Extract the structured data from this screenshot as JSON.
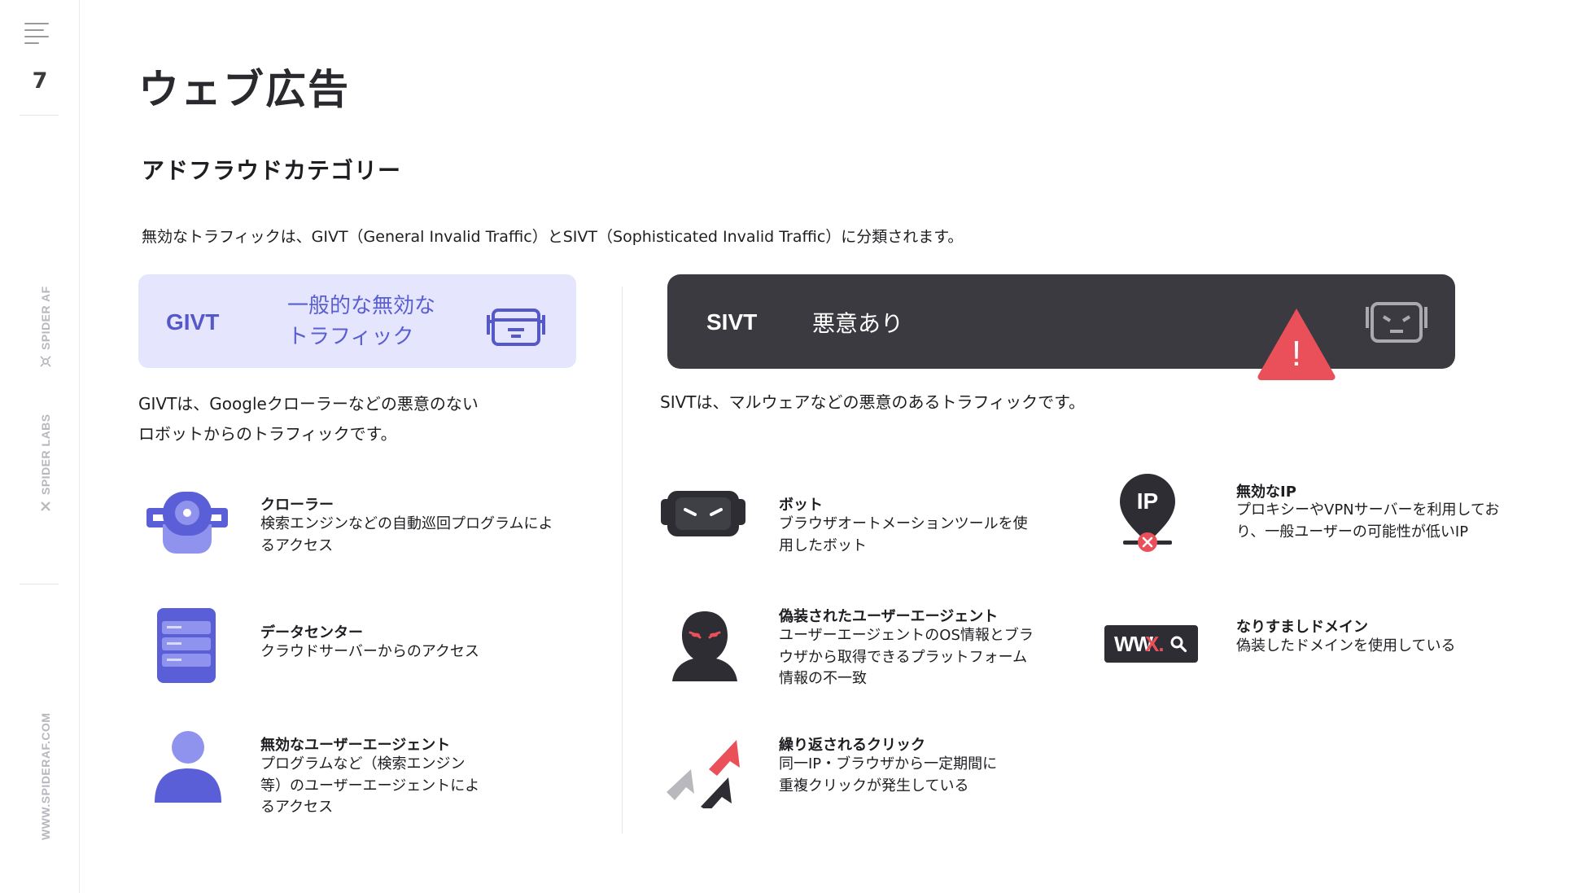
{
  "rail": {
    "page_number": "7",
    "brand_spider_af": "SPIDER AF",
    "brand_spider_labs": "SPIDER LABS",
    "website": "WWW.SPIDERAF.COM"
  },
  "title": "ウェブ広告",
  "section_title": "アドフラウドカテゴリー",
  "intro": "無効なトラフィックは、GIVT（General Invalid Traffic）とSIVT（Sophisticated Invalid Traffic）に分類されます。",
  "givt": {
    "label": "GIVT",
    "desc_line1": "一般的な無効な",
    "desc_line2": "トラフィック",
    "summary_line1": "GIVTは、Googleクローラーなどの悪意のない",
    "summary_line2": "ロボットからのトラフィックです。",
    "items": [
      {
        "icon": "crawler-robot-icon",
        "title": "クローラー",
        "lines": [
          "検索エンジンなどの自動巡回プログラムによ",
          "るアクセス"
        ]
      },
      {
        "icon": "data-center-server-icon",
        "title": "データセンター",
        "lines": [
          "クラウドサーバーからのアクセス"
        ]
      },
      {
        "icon": "user-agent-person-icon",
        "title": "無効なユーザーエージェント",
        "lines": [
          "プログラムなど（検索エンジン",
          "等）のユーザーエージェントによ",
          "るアクセス"
        ]
      }
    ]
  },
  "sivt": {
    "label": "SIVT",
    "desc": "悪意あり",
    "summary": "SIVTは、マルウェアなどの悪意のあるトラフィックです。",
    "warning_mark": "!",
    "items": [
      {
        "icon": "bot-face-icon",
        "title": "ボット",
        "lines": [
          "ブラウザオートメーションツールを使",
          "用したボット"
        ]
      },
      {
        "icon": "invalid-ip-pin-icon",
        "badge": "IP",
        "title": "無効なIP",
        "lines": [
          "プロキシーやVPNサーバーを利用してお",
          "り、一般ユーザーの可能性が低いIP"
        ]
      },
      {
        "icon": "masked-hacker-icon",
        "title": "偽装されたユーザーエージェント",
        "lines": [
          "ユーザーエージェントのOS情報とブラ",
          "ウザから取得できるプラットフォーム",
          "情報の不一致"
        ]
      },
      {
        "icon": "spoofed-domain-icon",
        "badge_w": "WW",
        "badge_x": "X.",
        "title": "なりすましドメイン",
        "lines": [
          "偽装したドメインを使用している"
        ]
      },
      {
        "icon": "repeated-click-cursor-icon",
        "title": "繰り返されるクリック",
        "lines": [
          "同一IP・ブラウザから一定期間に",
          "重複クリックが発生している"
        ]
      }
    ]
  },
  "colors": {
    "givt_bg": "#e5e6fd",
    "givt_accent": "#5458c9",
    "sivt_bg": "#3a3a40",
    "alert_red": "#e9505a"
  }
}
